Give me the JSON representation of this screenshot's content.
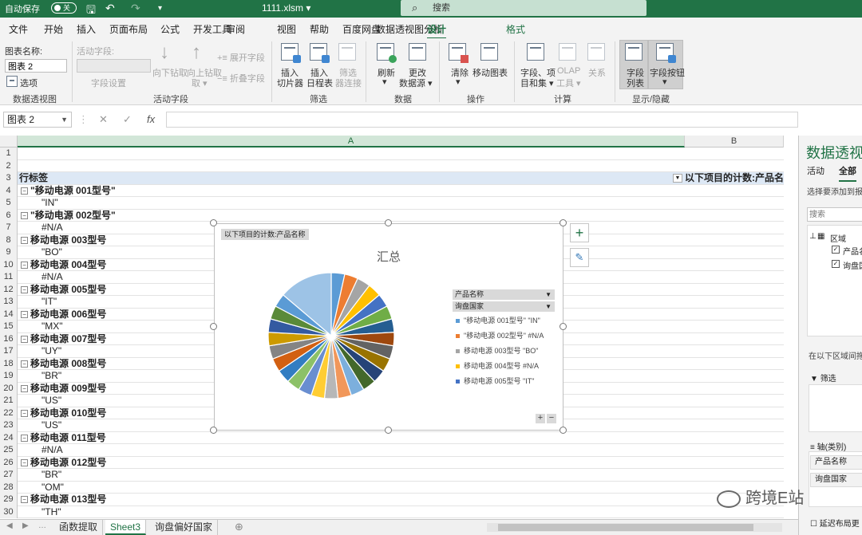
{
  "titlebar": {
    "autosave_label": "自动保存",
    "autosave_state": "关",
    "filename": "1111.xlsm ▾",
    "search_placeholder": "搜索"
  },
  "ribbon_tabs": [
    "文件",
    "开始",
    "插入",
    "页面布局",
    "公式",
    "开发工具",
    "审阅",
    "视图",
    "帮助",
    "百度网盘",
    "数据透视图分析",
    "设计",
    "格式"
  ],
  "ribbon": {
    "pivot_name_label": "图表名称:",
    "pivot_name_value": "图表 2",
    "options_label": "选项",
    "active_field_label": "活动字段:",
    "field_settings_label": "字段设置",
    "drill_down_label": "向下钻取",
    "drill_up_label": "向上钻取",
    "drill_up_suffix": "取 ▾",
    "expand_field_label": "展开字段",
    "collapse_field_label": "折叠字段",
    "insert_slicer_label": [
      "插入",
      "切片器"
    ],
    "insert_timeline_label": [
      "插入",
      "日程表"
    ],
    "filter_connections_label": [
      "筛选",
      "器连接"
    ],
    "refresh_label": [
      "刷新",
      "▾"
    ],
    "change_source_label": [
      "更改",
      "数据源 ▾"
    ],
    "clear_label": [
      "清除",
      "▾"
    ],
    "move_chart_label": "移动图表",
    "fields_items_label": [
      "字段、项",
      "目和集 ▾"
    ],
    "olap_label": [
      "OLAP",
      "工具 ▾"
    ],
    "relations_label": "关系",
    "field_list_label": [
      "字段",
      "列表"
    ],
    "field_buttons_label": [
      "字段按钮",
      "▾"
    ],
    "groups": [
      "数据透视图",
      "活动字段",
      "筛选",
      "数据",
      "操作",
      "计算",
      "显示/隐藏"
    ]
  },
  "formulabar": {
    "namebox": "图表 2",
    "cancel": "✕",
    "confirm": "✓",
    "fx": "fx",
    "value": ""
  },
  "columns": [
    "A",
    "B"
  ],
  "grid_rows": [
    {
      "n": "1",
      "text": "",
      "style": "plain"
    },
    {
      "n": "2",
      "text": "",
      "style": "plain"
    },
    {
      "n": "3",
      "text": "行标签",
      "style": "header",
      "b": "以下项目的计数:产品名称"
    },
    {
      "n": "4",
      "text": "\"移动电源 001型号\"",
      "style": "group-q"
    },
    {
      "n": "5",
      "text": "\"IN\"",
      "style": "child-q"
    },
    {
      "n": "6",
      "text": "\"移动电源 002型号\"",
      "style": "group-q"
    },
    {
      "n": "7",
      "text": "#N/A",
      "style": "child"
    },
    {
      "n": "8",
      "text": "移动电源 003型号",
      "style": "group"
    },
    {
      "n": "9",
      "text": "\"BO\"",
      "style": "child-q"
    },
    {
      "n": "10",
      "text": "移动电源 004型号",
      "style": "group"
    },
    {
      "n": "11",
      "text": "#N/A",
      "style": "child"
    },
    {
      "n": "12",
      "text": "移动电源 005型号",
      "style": "group"
    },
    {
      "n": "13",
      "text": "\"IT\"",
      "style": "child-q"
    },
    {
      "n": "14",
      "text": "移动电源 006型号",
      "style": "group"
    },
    {
      "n": "15",
      "text": "\"MX\"",
      "style": "child-q"
    },
    {
      "n": "16",
      "text": "移动电源 007型号",
      "style": "group"
    },
    {
      "n": "17",
      "text": "\"UY\"",
      "style": "child-q"
    },
    {
      "n": "18",
      "text": "移动电源 008型号",
      "style": "group"
    },
    {
      "n": "19",
      "text": "\"BR\"",
      "style": "child-q"
    },
    {
      "n": "20",
      "text": "移动电源 009型号",
      "style": "group"
    },
    {
      "n": "21",
      "text": "\"US\"",
      "style": "child-q"
    },
    {
      "n": "22",
      "text": "移动电源 010型号",
      "style": "group"
    },
    {
      "n": "23",
      "text": "\"US\"",
      "style": "child-q"
    },
    {
      "n": "24",
      "text": "移动电源 011型号",
      "style": "group"
    },
    {
      "n": "25",
      "text": "#N/A",
      "style": "child"
    },
    {
      "n": "26",
      "text": "移动电源 012型号",
      "style": "group"
    },
    {
      "n": "27",
      "text": "\"BR\"",
      "style": "child-q"
    },
    {
      "n": "28",
      "text": "\"OM\"",
      "style": "child-q"
    },
    {
      "n": "29",
      "text": "移动电源 013型号",
      "style": "group"
    },
    {
      "n": "30",
      "text": "\"TH\"",
      "style": "child-q"
    }
  ],
  "chart": {
    "value_button": "以下项目的计数:产品名称",
    "title": "汇总",
    "field_buttons": [
      "产品名称",
      "询盘国家"
    ],
    "legend": [
      {
        "label": "\"移动电源 001型号\" \"IN\"",
        "color": "#5b9bd5"
      },
      {
        "label": "\"移动电源 002型号\" #N/A",
        "color": "#ed7d31"
      },
      {
        "label": "移动电源 003型号 \"BO\"",
        "color": "#a5a5a5"
      },
      {
        "label": "移动电源 004型号 #N/A",
        "color": "#ffc000"
      },
      {
        "label": "移动电源 005型号 \"IT\"",
        "color": "#4472c4"
      }
    ],
    "zoom_plus": "+",
    "zoom_minus": "−",
    "add_element_icon": "+",
    "style_icon": "✎"
  },
  "chart_data": {
    "type": "pie",
    "title": "汇总",
    "slice_count": 26,
    "values": [
      1,
      1,
      1,
      1,
      1,
      1,
      1,
      1,
      1,
      1,
      1,
      1,
      1,
      1,
      1,
      1,
      1,
      1,
      1,
      1,
      1,
      1,
      1,
      1,
      1,
      4
    ],
    "colors": [
      "#5b9bd5",
      "#ed7d31",
      "#a5a5a5",
      "#ffc000",
      "#4472c4",
      "#70ad47",
      "#255e91",
      "#9e480e",
      "#636363",
      "#997300",
      "#264478",
      "#43682b",
      "#7cafdd",
      "#f1975a",
      "#b7b7b7",
      "#ffcd33",
      "#698ed0",
      "#8cc168",
      "#327dc2",
      "#d26012",
      "#848484",
      "#cc9a00",
      "#335aa1",
      "#5a8a39",
      "#5b9bd5",
      "#9dc3e6"
    ],
    "legend_position": "right"
  },
  "sheets": [
    "函数提取",
    "Sheet3",
    "询盘偏好国家"
  ],
  "active_sheet": "Sheet3",
  "panel": {
    "title": "数据透视",
    "tabs": [
      "活动",
      "全部"
    ],
    "hint": "选择要添加到报",
    "search_placeholder": "搜索",
    "tree_root": "区域",
    "fields": [
      "产品名",
      "询盘国"
    ],
    "areas_hint": "在以下区域间拖",
    "filter_label": "筛选",
    "axis_label": "轴(类别)",
    "axis_items": [
      "产品名称",
      "询盘国家"
    ],
    "defer_label": "延迟布局更"
  },
  "watermark": "跨境E站"
}
